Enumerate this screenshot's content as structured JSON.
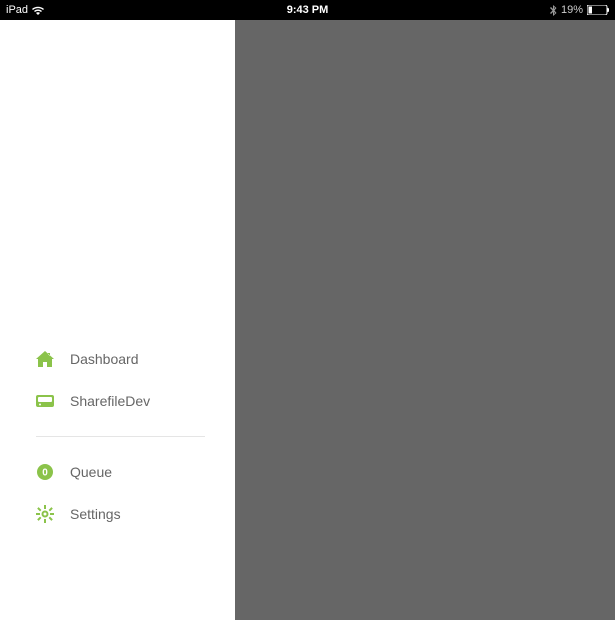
{
  "status_bar": {
    "device": "iPad",
    "time": "9:43 PM",
    "battery_percent": "19%"
  },
  "sidebar": {
    "items": [
      {
        "label": "Dashboard"
      },
      {
        "label": "SharefileDev"
      },
      {
        "label": "Queue"
      },
      {
        "label": "Settings"
      }
    ]
  },
  "accent_color": "#8bc34a"
}
